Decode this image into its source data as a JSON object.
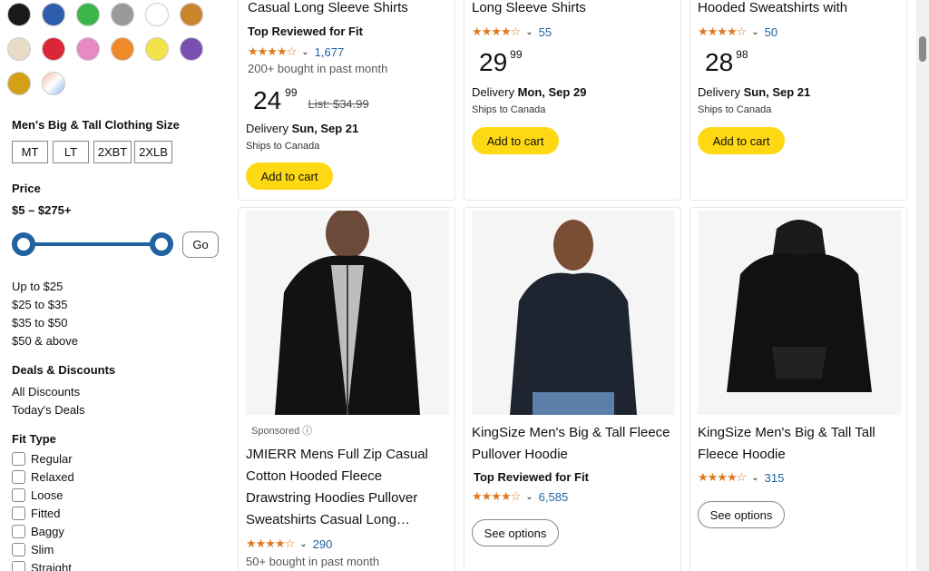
{
  "filters": {
    "size_title": "Men's Big & Tall Clothing Size",
    "sizes": [
      "MT",
      "LT",
      "2XBT",
      "2XLB"
    ],
    "price_title": "Price",
    "price_range": "$5 – $275+",
    "go_label": "Go",
    "price_links": [
      "Up to $25",
      "$25 to $35",
      "$35 to $50",
      "$50 & above"
    ],
    "deals_title": "Deals & Discounts",
    "deals_links": [
      "All Discounts",
      "Today's Deals"
    ],
    "fit_title": "Fit Type",
    "fit_options": [
      "Regular",
      "Relaxed",
      "Loose",
      "Fitted",
      "Baggy",
      "Slim",
      "Straight"
    ],
    "swatch_colors_row1": [
      "#1a1a1a",
      "#2f5dad",
      "#3ab54a",
      "#9a9a9a",
      "#ffffff",
      "#c8852e"
    ],
    "swatch_colors_row2": [
      "#e8dcc8",
      "#d92639",
      "#e78ac3",
      "#ee8a2a",
      "#f2e34b",
      "#7a4fb0"
    ],
    "swatch_colors_row3": [
      "#d4a017",
      "#e6e6f0"
    ]
  },
  "products": [
    {
      "title": "Casual Long Sleeve Shirts",
      "badge_a": "Top Reviewed",
      "badge_b": "for Fit",
      "stars": "★★★★☆",
      "rating": "1,677",
      "bought": "200+ bought in past month",
      "price_dollars": "24",
      "price_cents": "99",
      "list_price": "List: $34.99",
      "delivery_prefix": "Delivery ",
      "delivery_date": "Sun, Sep 21",
      "ships": "Ships to Canada",
      "button": "Add to cart"
    },
    {
      "title": "Long Sleeve Shirts",
      "stars": "★★★★☆",
      "rating": "55",
      "price_dollars": "29",
      "price_cents": "99",
      "delivery_prefix": "Delivery ",
      "delivery_date": "Mon, Sep 29",
      "ships": "Ships to Canada",
      "button": "Add to cart"
    },
    {
      "title": "Hooded Sweatshirts with",
      "stars": "★★★★☆",
      "rating": "50",
      "price_dollars": "28",
      "price_cents": "98",
      "delivery_prefix": "Delivery ",
      "delivery_date": "Sun, Sep 21",
      "ships": "Ships to Canada",
      "button": "Add to cart"
    },
    {
      "sponsored": "Sponsored ⓘ",
      "title": "JMIERR Mens Full Zip Casual Cotton Hooded Fleece Drawstring Hoodies Pullover Sweatshirts Casual Long…",
      "stars": "★★★★☆",
      "rating": "290",
      "bought": "50+ bought in past month"
    },
    {
      "title": "KingSize Men's Big & Tall Fleece Pullover Hoodie",
      "badge_a": "Top Reviewed",
      "badge_b": "for Fit",
      "stars": "★★★★☆",
      "rating": "6,585",
      "button": "See options"
    },
    {
      "title": "KingSize Men's Big & Tall Tall Fleece Hoodie",
      "stars": "★★★★☆",
      "rating": "315",
      "button": "See options"
    }
  ]
}
